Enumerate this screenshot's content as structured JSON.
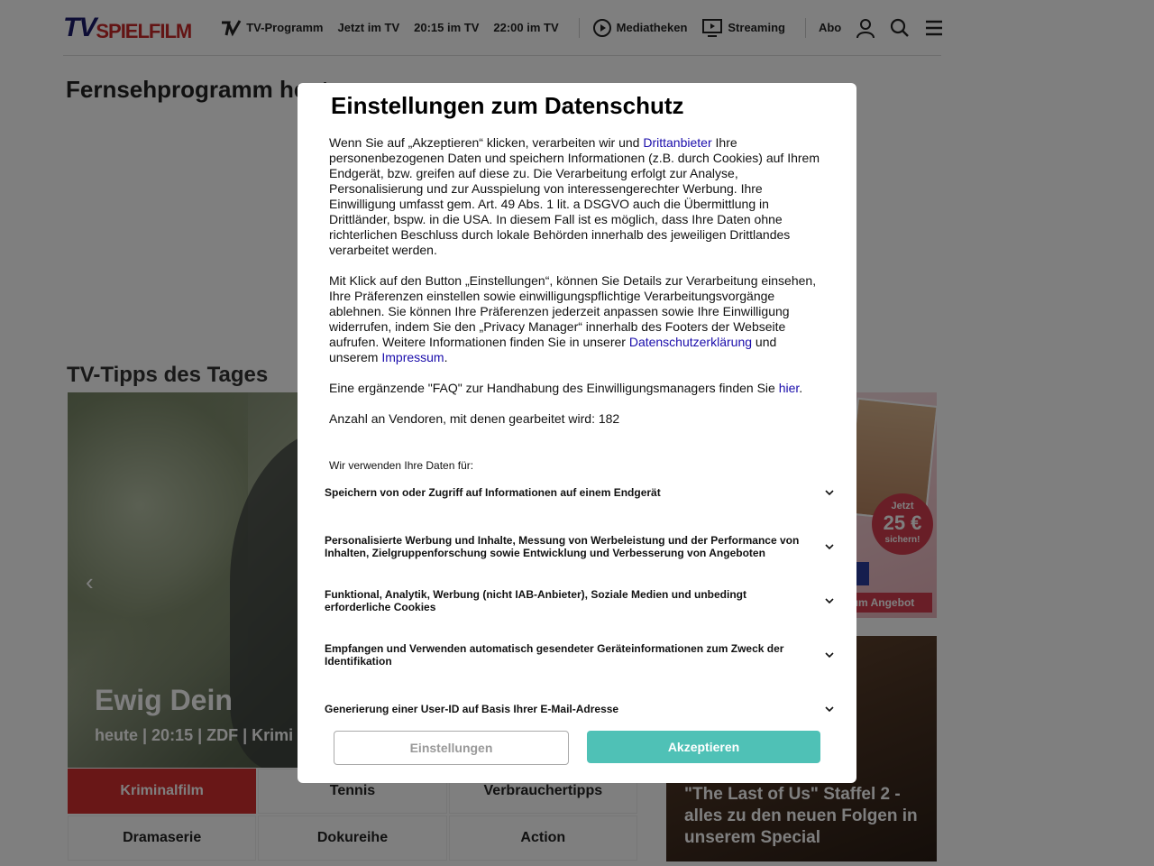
{
  "header": {
    "logo_tv": "TV",
    "logo_rest": "SPIELFILM",
    "nav": [
      "TV-Programm",
      "Jetzt im TV",
      "20:15 im TV",
      "22:00 im TV"
    ],
    "nav_media": "Mediatheken",
    "nav_streaming": "Streaming",
    "abo": "Abo"
  },
  "page_title": "Fernsehprogramm heute",
  "tips_title": "TV-Tipps des Tages",
  "hero": {
    "title": "Ewig Dein",
    "subtitle": "heute | 20:15 | ZDF | Krimi"
  },
  "categories": [
    "Kriminalfilm",
    "Tennis",
    "Verbrauchertipps",
    "Dramaserie",
    "Dokureihe",
    "Action"
  ],
  "ad": {
    "badge_line1": "Jetzt",
    "badge_line2": "25 €",
    "badge_line3": "sichern!",
    "cta": "zum Angebot"
  },
  "story": {
    "text": "\"The Last of Us\" Staffel 2 - alles zu den neuen Folgen in unserem Special"
  },
  "consent": {
    "title": "Einstellungen zum Datenschutz",
    "p1_a": "Wenn Sie auf „Akzeptieren“ klicken, verarbeiten wir und ",
    "p1_link": "Drittanbieter",
    "p1_b": " Ihre personenbezogenen Daten und speichern Informationen (z.B. durch Cookies) auf Ihrem Endgerät, bzw. greifen auf diese zu. Die Verarbeitung erfolgt zur Analyse, Personalisierung und zur Ausspielung von interessengerechter Werbung. Ihre Einwilligung umfasst gem. Art. 49 Abs. 1 lit. a DSGVO auch die Übermittlung in Drittländer, bspw. in die USA. In diesem Fall ist es möglich, dass Ihre Daten ohne richterlichen Beschluss durch lokale Behörden innerhalb des jeweiligen Drittlandes verarbeitet werden.",
    "p2_a": "Mit Klick auf den Button „Einstellungen“, können Sie Details zur Verarbeitung einsehen, Ihre Präferenzen einstellen sowie einwilligungspflichtige Verarbeitungsvorgänge ablehnen. Sie können Ihre Präferenzen jederzeit anpassen sowie Ihre Einwilligung widerrufen, indem Sie den „Privacy Manager“ innerhalb des Footers der Webseite aufrufen. Weitere Informationen finden Sie in unserer ",
    "p2_link1": "Datenschutzerklärung",
    "p2_b": " und unserem ",
    "p2_link2": "Impressum",
    "p2_c": ".",
    "p3_a": "Eine ergänzende \"FAQ\" zur Handhabung des Einwilligungsmanagers finden Sie ",
    "p3_link": "hier",
    "p3_b": ".",
    "p4": "Anzahl an Vendoren, mit denen gearbeitet wird: 182",
    "use_label": "Wir verwenden Ihre Daten für:",
    "purposes": [
      "Speichern von oder Zugriff auf Informationen auf einem Endgerät",
      "Personalisierte Werbung und Inhalte, Messung von Werbeleistung und der Performance von Inhalten, Zielgruppenforschung sowie Entwicklung und Verbesserung von Angeboten",
      "Funktional, Analytik, Werbung (nicht IAB-Anbieter), Soziale Medien und unbedingt erforderliche Cookies",
      "Empfangen und Verwenden automatisch gesendeter Geräteinformationen zum Zweck der Identifikation",
      "Generierung einer User-ID auf Basis Ihrer E-Mail-Adresse"
    ],
    "btn_settings": "Einstellungen",
    "btn_accept": "Akzeptieren",
    "accent": "#4fc1b6"
  }
}
